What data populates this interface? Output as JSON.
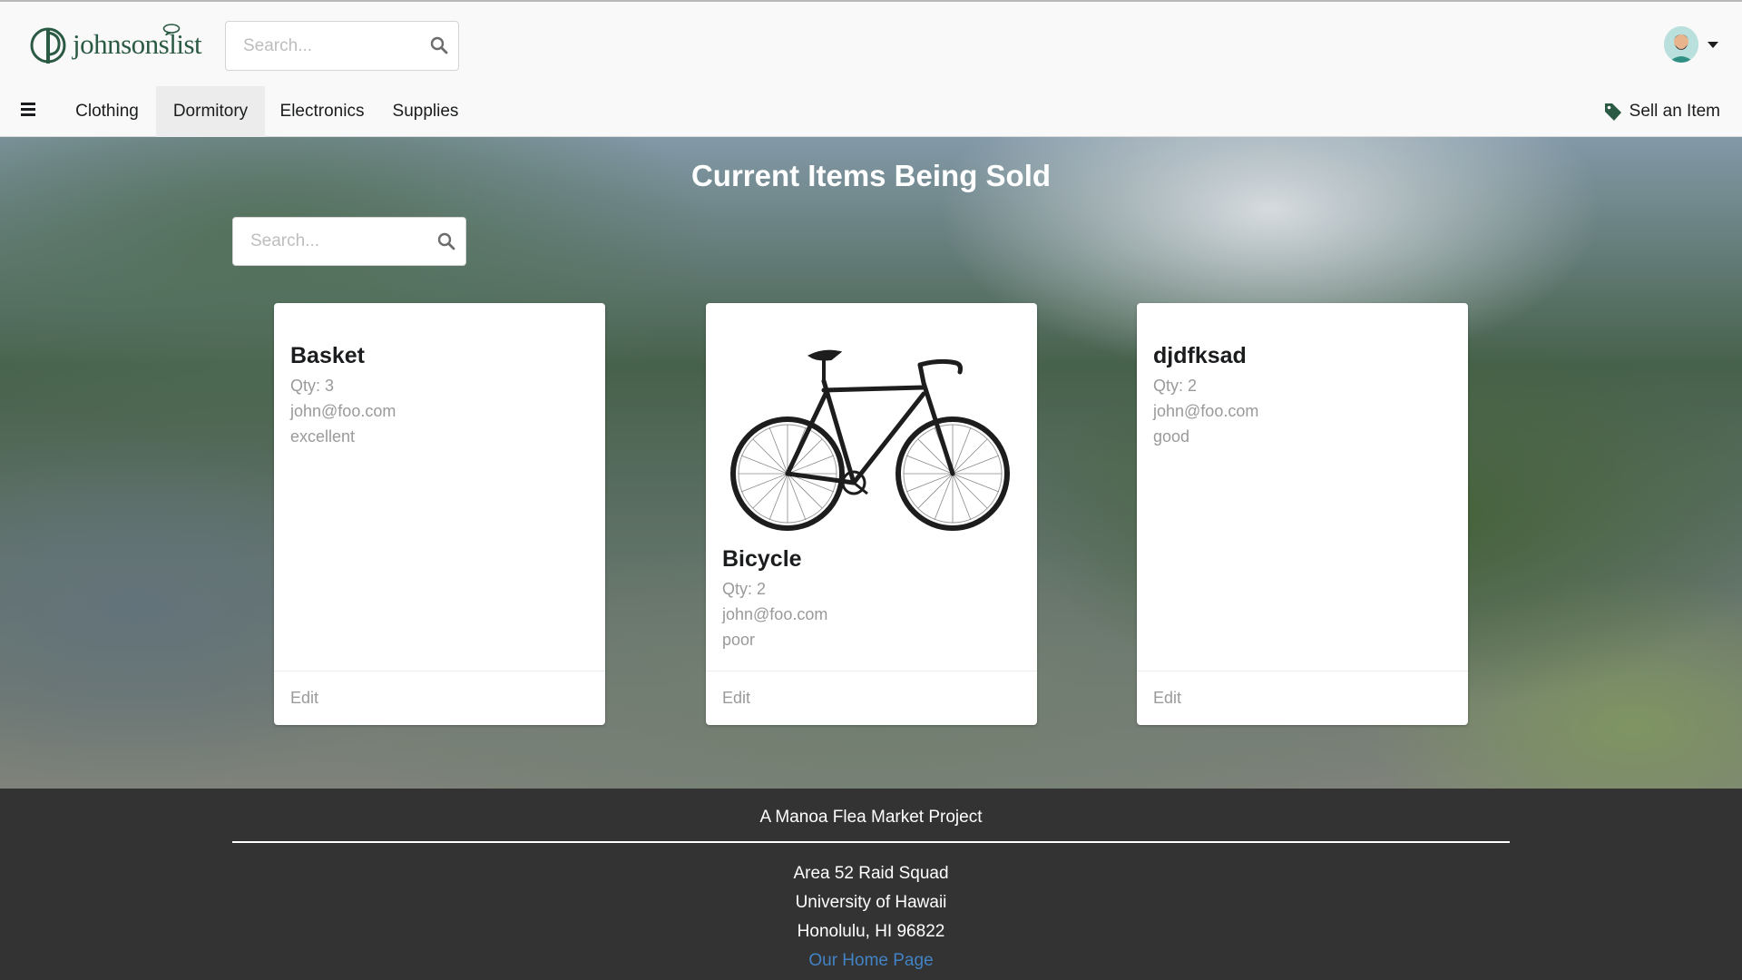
{
  "brand": {
    "name": "johnsonslist"
  },
  "header": {
    "search_placeholder": "Search..."
  },
  "nav": {
    "items": [
      {
        "label": "Clothing"
      },
      {
        "label": "Dormitory"
      },
      {
        "label": "Electronics"
      },
      {
        "label": "Supplies"
      }
    ],
    "active": "Dormitory",
    "sell_label": "Sell an Item"
  },
  "main": {
    "title": "Current Items Being Sold",
    "search_placeholder": "Search...",
    "cards": [
      {
        "title": "Basket",
        "qty": "Qty: 3",
        "email": "john@foo.com",
        "condition": "excellent",
        "edit": "Edit",
        "image": "none"
      },
      {
        "title": "Bicycle",
        "qty": "Qty: 2",
        "email": "john@foo.com",
        "condition": "poor",
        "edit": "Edit",
        "image": "bicycle"
      },
      {
        "title": "djdfksad",
        "qty": "Qty: 2",
        "email": "john@foo.com",
        "condition": "good",
        "edit": "Edit",
        "image": "none"
      }
    ]
  },
  "footer": {
    "title": "A Manoa Flea Market Project",
    "lines": [
      "Area 52 Raid Squad",
      "University of Hawaii",
      "Honolulu, HI 96822"
    ],
    "link_label": "Our Home Page"
  },
  "colors": {
    "brand_green": "#2b5a44",
    "footer_bg": "#333333",
    "link_blue": "#4183c4"
  },
  "icons": [
    "search-icon",
    "hamburger-icon",
    "tag-icon",
    "caret-down-icon",
    "avatar"
  ]
}
